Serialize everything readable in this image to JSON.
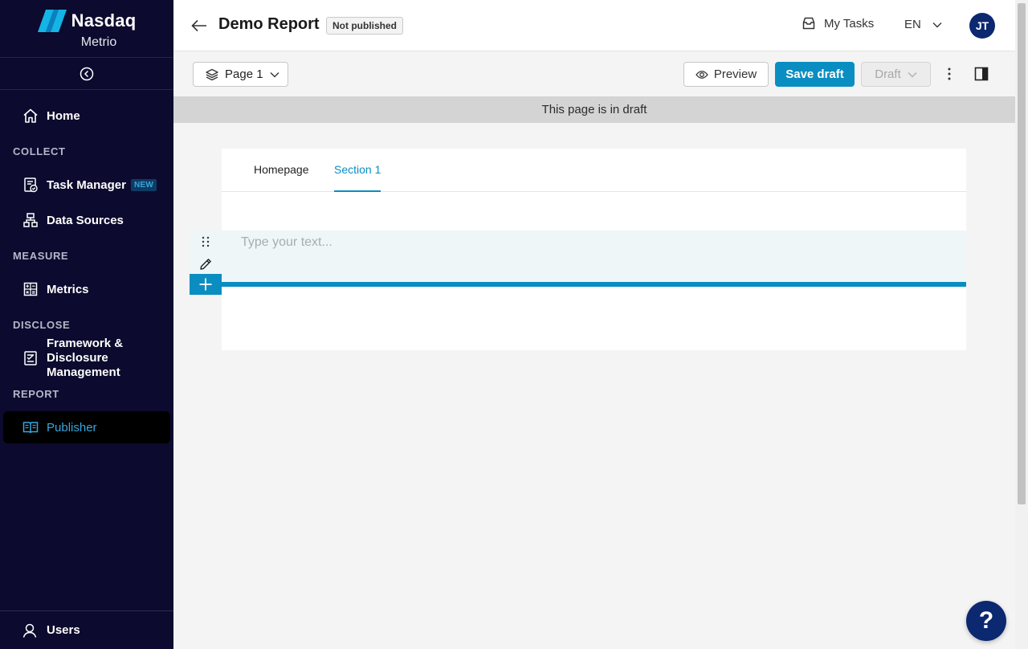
{
  "brand": {
    "name": "Nasdaq",
    "product": "Metrio"
  },
  "sidebar": {
    "home": "Home",
    "sections": {
      "collect": "COLLECT",
      "measure": "MEASURE",
      "disclose": "DISCLOSE",
      "report": "REPORT"
    },
    "items": {
      "task_manager": "Task Manager",
      "task_manager_badge": "NEW",
      "data_sources": "Data Sources",
      "metrics": "Metrics",
      "framework_line1": "Framework &",
      "framework_line2": "Disclosure",
      "framework_line3": "Management",
      "publisher": "Publisher"
    },
    "users": "Users"
  },
  "header": {
    "title": "Demo Report",
    "status": "Not published",
    "my_tasks": "My Tasks",
    "language": "EN",
    "avatar_initials": "JT"
  },
  "toolbar": {
    "page_select": "Page 1",
    "preview": "Preview",
    "save_draft": "Save draft",
    "draft_status": "Draft"
  },
  "banner": {
    "text": "This page is in draft"
  },
  "editor": {
    "tabs": [
      "Homepage",
      "Section 1"
    ],
    "active_tab_index": 1,
    "placeholder": "Type your text..."
  },
  "help": {
    "label": "?"
  },
  "colors": {
    "sidebar_bg": "#0c0a2e",
    "accent": "#0a8ec2",
    "avatar_bg": "#0c2870",
    "active_nav_text": "#38a6dc"
  },
  "icons": {
    "back": "arrow-left-icon",
    "collapse": "chevron-left-circle-icon",
    "home": "home-icon",
    "task_manager": "clipboard-check-icon",
    "data_sources": "sitemap-icon",
    "metrics": "calculator-icon",
    "framework": "document-check-icon",
    "publisher": "book-open-icon",
    "users": "user-icon",
    "my_tasks": "inbox-icon",
    "layers": "layers-icon",
    "preview": "eye-icon",
    "kebab": "more-vertical-icon",
    "panel": "sidebar-panel-icon",
    "drag": "drag-handle-icon",
    "edit": "pencil-icon",
    "add": "plus-icon"
  }
}
